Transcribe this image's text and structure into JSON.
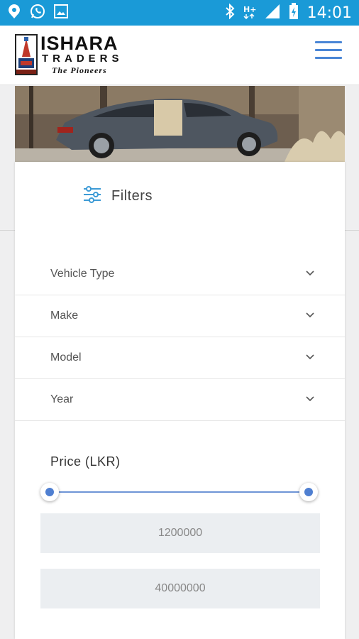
{
  "status_bar": {
    "time": "14:01",
    "color": "#1a9ad7",
    "left_icons": [
      "location-chat-icon",
      "whatsapp-icon",
      "gallery-icon"
    ],
    "right_icons": [
      "bluetooth-icon",
      "hplus-signal-icon",
      "signal-bars-icon",
      "battery-charging-icon"
    ]
  },
  "header": {
    "logo": {
      "name": "ISHARA",
      "sub": "TRADERS",
      "tagline": "The Pioneers"
    },
    "menu_icon": "hamburger-menu-icon",
    "accent_color": "#4a86d6"
  },
  "filters": {
    "title": "Filters",
    "icon": "sliders-icon",
    "selects": [
      {
        "label": "Vehicle Type"
      },
      {
        "label": "Make"
      },
      {
        "label": "Model"
      },
      {
        "label": "Year"
      }
    ],
    "price": {
      "label": "Price (LKR)",
      "min_value": "1200000",
      "max_value": "40000000",
      "slider_low_fraction": 0.0,
      "slider_high_fraction": 1.0
    }
  }
}
